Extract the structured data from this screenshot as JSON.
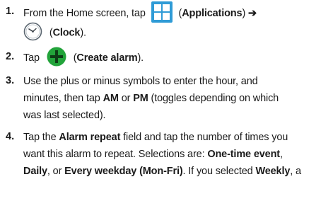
{
  "steps": [
    {
      "number": "1.",
      "line1": {
        "pre": "From the Home screen, tap",
        "paren_open": "(",
        "bold": "Applications",
        "paren_close": ")",
        "arrow": "➔"
      },
      "line2": {
        "paren_open": "(",
        "bold": "Clock",
        "paren_close": ")."
      }
    },
    {
      "number": "2.",
      "pre": "Tap",
      "paren_open": "(",
      "bold": "Create alarm",
      "paren_close": ")."
    },
    {
      "number": "3.",
      "lines": [
        "Use the plus or minus symbols to enter the hour, and",
        "minutes, then tap ",
        "AM",
        " or ",
        "PM",
        " (toggles depending on which",
        "was last selected)."
      ]
    },
    {
      "number": "4.",
      "l1_pre": "Tap the ",
      "l1_bold": "Alarm repeat",
      "l1_post": " field and tap the number of times you",
      "l2_pre": "want this alarm to repeat. Selections are: ",
      "l2_bold": "One-time event",
      "l2_post": ",",
      "l3_bold1": "Daily",
      "l3_mid1": ", or ",
      "l3_bold2": "Every weekday (Mon-Fri)",
      "l3_mid2": ". If you selected ",
      "l3_bold3": "Weekly",
      "l3_post": ", a"
    }
  ],
  "icons": {
    "applications": {
      "name": "applications-icon",
      "color": "#2f9bd6"
    },
    "clock": {
      "name": "clock-icon",
      "color": "#5b6670"
    },
    "create_alarm": {
      "name": "plus-circle-icon",
      "color": "#22a33a"
    }
  }
}
